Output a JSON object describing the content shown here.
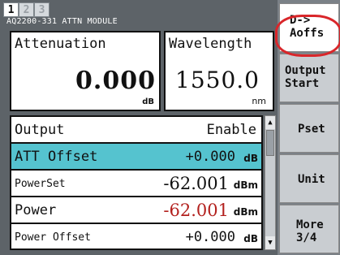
{
  "page_tabs": [
    "1",
    "2",
    "3"
  ],
  "active_tab": "1",
  "module_title": "AQ2200-331 ATTN MODULE",
  "attenuation": {
    "label": "Attenuation",
    "value": "0.000",
    "unit": "dB"
  },
  "wavelength": {
    "label": "Wavelength",
    "value": "1550.0",
    "unit": "nm"
  },
  "rows": [
    {
      "name": "Output",
      "value": "Enable",
      "unit": ""
    },
    {
      "name": "ATT Offset",
      "value": "+0.000",
      "unit": "dB",
      "selected": true
    },
    {
      "name": "PowerSet",
      "value": "-62.001",
      "unit": "dBm"
    },
    {
      "name": "Power",
      "value": "-62.001",
      "unit": "dBm",
      "color": "#b3211e"
    },
    {
      "name": "Power Offset",
      "value": "+0.000",
      "unit": "dB"
    }
  ],
  "softkeys": [
    {
      "label": "D->\nAoffs"
    },
    {
      "label": "Output\nStart"
    },
    {
      "label": "Pset"
    },
    {
      "label": "Unit"
    },
    {
      "label": "More\n3/4"
    }
  ],
  "scroll_icons": {
    "up": "triangle-up-icon",
    "down": "triangle-down-icon"
  },
  "colors": {
    "selected_row": "#55c3cf",
    "highlight_ring": "#d9262a",
    "power_value": "#b3211e"
  }
}
